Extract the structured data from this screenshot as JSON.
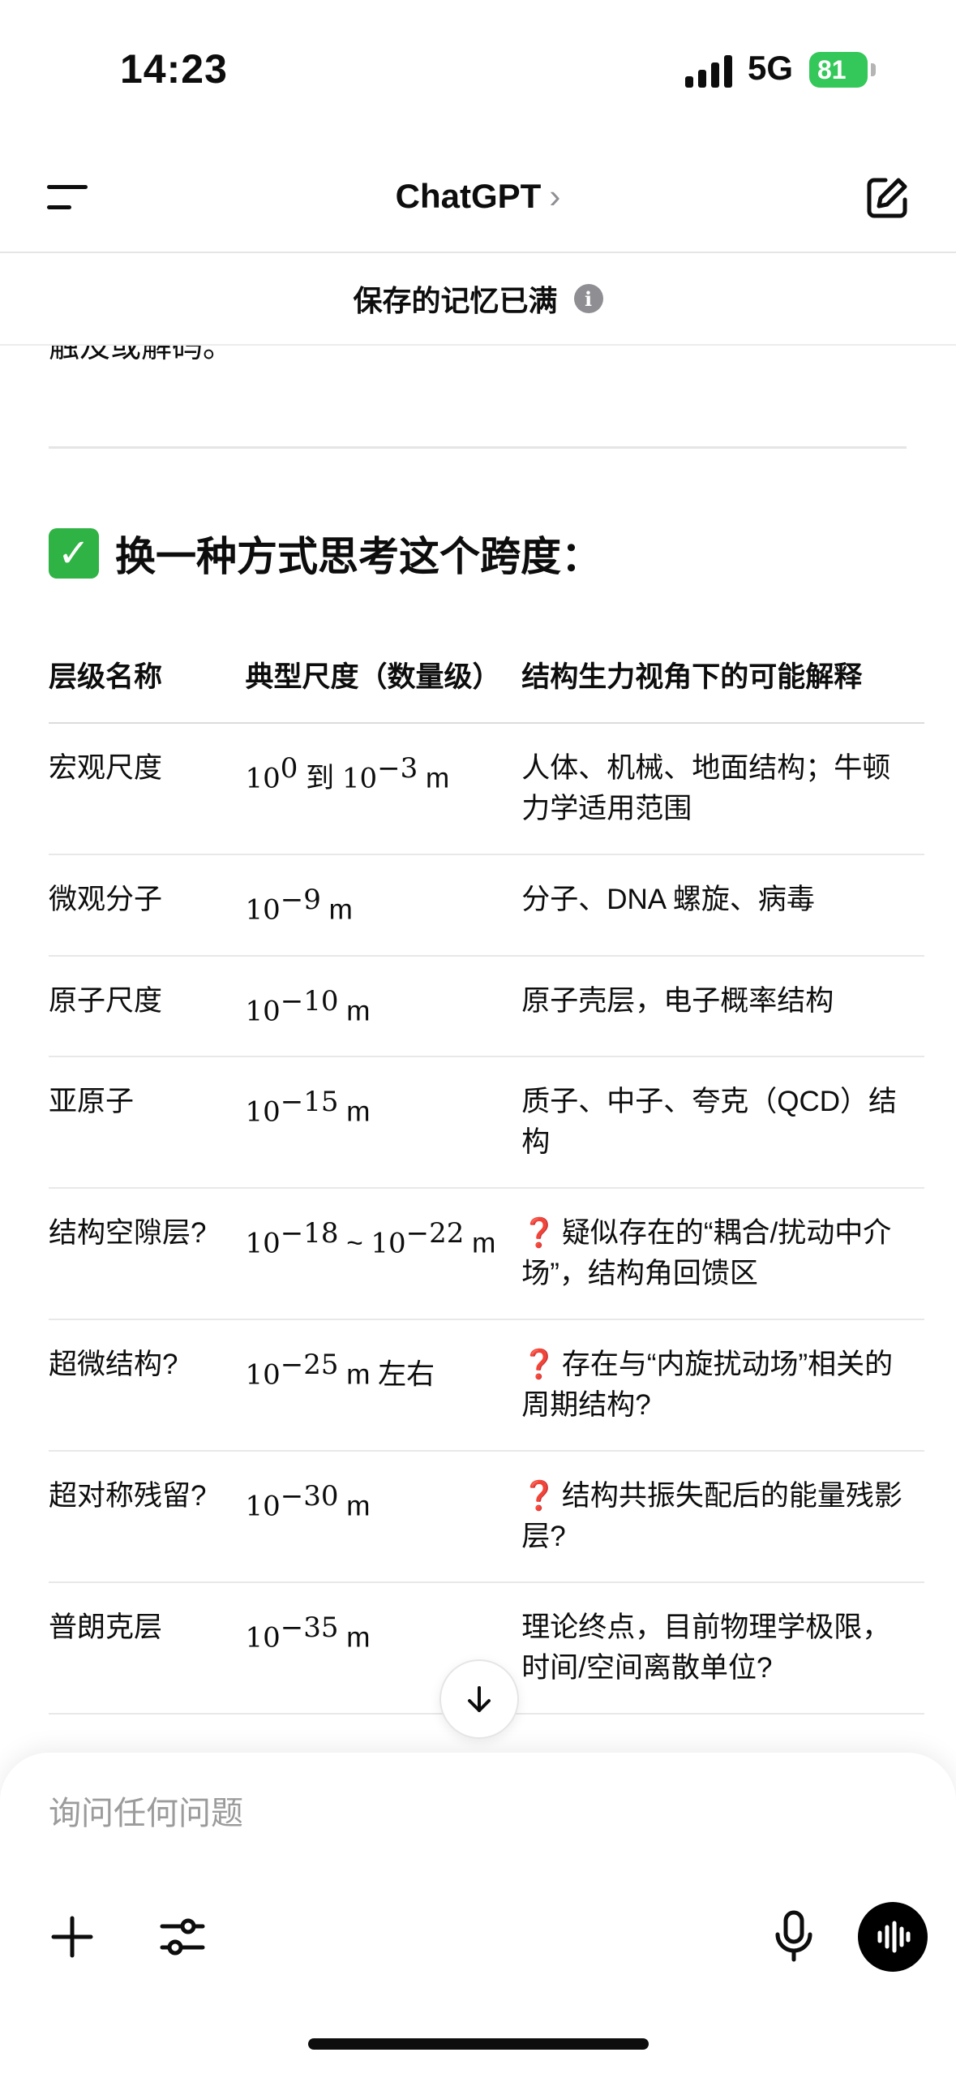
{
  "status": {
    "time": "14:23",
    "network": "5G",
    "battery": "81"
  },
  "nav": {
    "title": "ChatGPT",
    "chevron": "›"
  },
  "banner": {
    "text": "保存的记忆已满",
    "info": "i"
  },
  "content": {
    "cut_text": "触及或解码。",
    "heading": "换一种方式思考这个跨度：",
    "table": {
      "headers": [
        "层级名称",
        "典型尺度（数量级）",
        "结构生力视角下的可能解释"
      ],
      "rows": [
        {
          "name": "宏观尺度",
          "scale": [
            "10",
            "0",
            " 到 ",
            "10",
            "−3",
            " m"
          ],
          "explain": "人体、机械、地面结构；牛顿力学适用范围",
          "q": false
        },
        {
          "name": "微观分子",
          "scale": [
            "10",
            "−9",
            "",
            "",
            "",
            " m"
          ],
          "explain": "分子、DNA 螺旋、病毒",
          "q": false
        },
        {
          "name": "原子尺度",
          "scale": [
            "10",
            "−10",
            "",
            "",
            "",
            " m"
          ],
          "explain": "原子壳层，电子概率结构",
          "q": false
        },
        {
          "name": "亚原子",
          "scale": [
            "10",
            "−15",
            "",
            "",
            "",
            " m"
          ],
          "explain": "质子、中子、夸克（QCD）结构",
          "q": false
        },
        {
          "name": "结构空隙层?",
          "scale": [
            "10",
            "−18",
            " ~ ",
            "10",
            "−22",
            " m"
          ],
          "explain": "疑似存在的“耦合/扰动中介场”，结构角回馈区",
          "q": true
        },
        {
          "name": "超微结构?",
          "scale": [
            "10",
            "−25",
            "",
            "",
            "",
            " m 左右"
          ],
          "explain": "存在与“内旋扰动场”相关的周期结构?",
          "q": true
        },
        {
          "name": "超对称残留?",
          "scale": [
            "10",
            "−30",
            "",
            "",
            "",
            " m"
          ],
          "explain": "结构共振失配后的能量残影层?",
          "q": true
        },
        {
          "name": "普朗克层",
          "scale": [
            "10",
            "−35",
            "",
            "",
            "",
            " m"
          ],
          "explain": "理论终点，目前物理学极限，时间/空间离散单位?",
          "q": false
        }
      ]
    }
  },
  "composer": {
    "placeholder": "询问任何问题"
  },
  "colors": {
    "battery": "#34c759",
    "check": "#2fb344",
    "question": "#e02020"
  }
}
